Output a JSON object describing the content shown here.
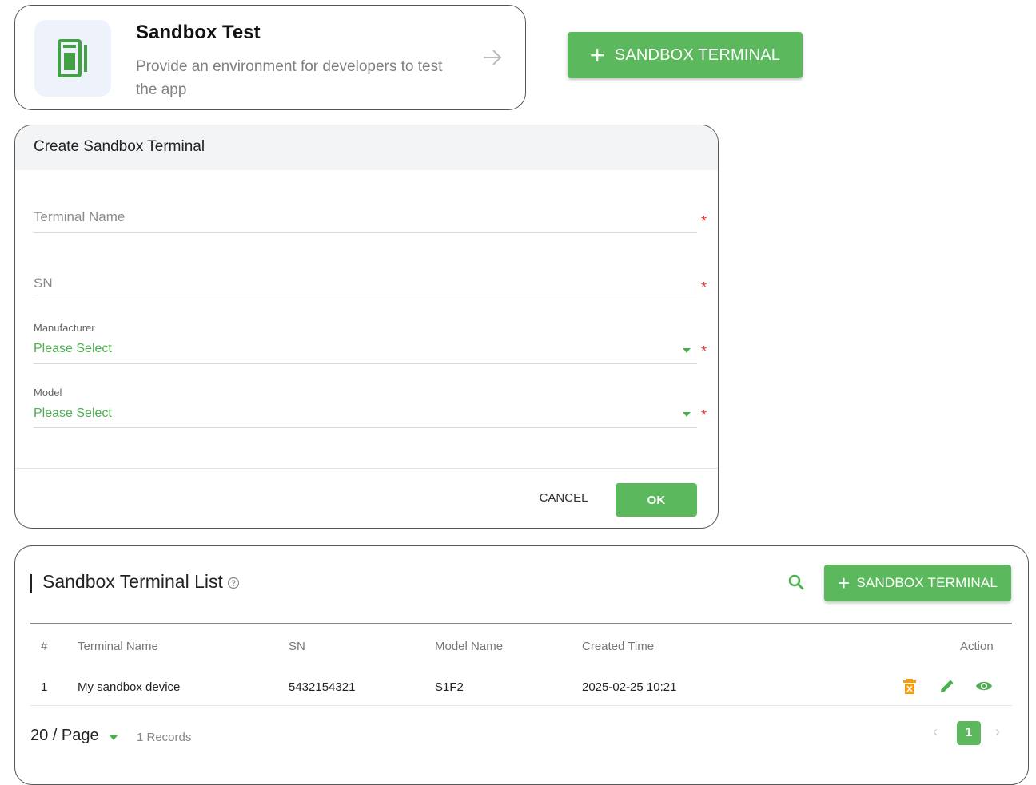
{
  "sandbox_card": {
    "title": "Sandbox Test",
    "description": "Provide an environment for developers to test the app",
    "icon": "device-icon",
    "arrow_icon": "arrow-right-icon"
  },
  "top_add_button": {
    "icon": "plus-icon",
    "label": "SANDBOX TERMINAL"
  },
  "dialog": {
    "title": "Create Sandbox Terminal",
    "terminal_name": {
      "placeholder": "Terminal Name",
      "required_mark": "*"
    },
    "sn": {
      "placeholder": "SN",
      "required_mark": "*"
    },
    "manufacturer": {
      "label": "Manufacturer",
      "value": "Please Select",
      "required_mark": "*"
    },
    "model": {
      "label": "Model",
      "value": "Please Select",
      "required_mark": "*"
    },
    "cancel_label": "CANCEL",
    "ok_label": "OK"
  },
  "list": {
    "title": "Sandbox Terminal List",
    "help_icon": "help-circle-icon",
    "search_icon": "search-icon",
    "add_button": {
      "icon": "plus-icon",
      "label": "SANDBOX TERMINAL"
    },
    "columns": [
      "#",
      "Terminal Name",
      "SN",
      "Model Name",
      "Created Time",
      "Action"
    ],
    "rows": [
      {
        "index": "1",
        "terminal_name": "My sandbox device",
        "sn": "5432154321",
        "model_name": "S1F2",
        "created_time": "2025-02-25 10:21"
      }
    ],
    "row_actions": [
      "delete-icon",
      "edit-icon",
      "view-icon"
    ],
    "page_size": "20 / Page",
    "records": "1 Records",
    "pagination": {
      "prev": "‹",
      "current": "1",
      "next": "›"
    }
  },
  "colors": {
    "accent": "#5cb85c",
    "required": "#e53935",
    "delete": "#f39c12",
    "select_text": "#4caf50"
  }
}
